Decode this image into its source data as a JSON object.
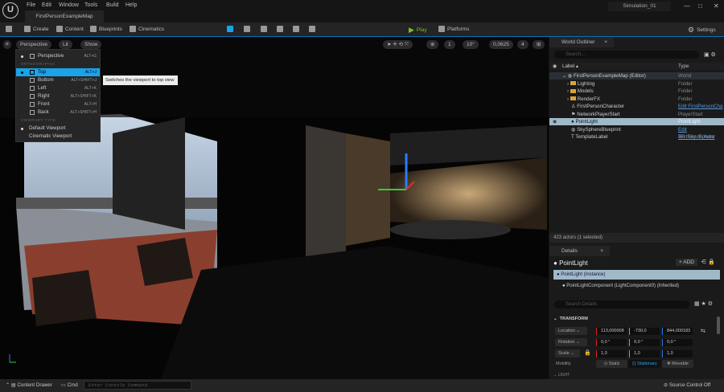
{
  "titlebar": {
    "logo": "U",
    "menus": [
      "File",
      "Edit",
      "Window",
      "Tools",
      "Build",
      "Help"
    ],
    "map_tab": "FirstPersonExampleMap",
    "project_tab": "Simulation_01",
    "window_controls": [
      "—",
      "□",
      "✕"
    ]
  },
  "toolbar": {
    "create": "Create",
    "content": "Content",
    "blueprints": "Blueprints",
    "cinematics": "Cinematics",
    "play": "Play",
    "platforms": "Platforms",
    "settings": "Settings"
  },
  "viewport": {
    "perspective": "Perspective",
    "lit": "Lit",
    "show": "Show",
    "grid_snap": "1",
    "rotation_snap": "10°",
    "scale_snap": "0,0625",
    "camera_speed": "4"
  },
  "view_menu": {
    "items": [
      {
        "label": "Perspective",
        "shortcut": "ALT+G"
      },
      {
        "label": "Top",
        "shortcut": "ALT+J"
      },
      {
        "label": "Bottom",
        "shortcut": "ALT+SHIFT+J"
      },
      {
        "label": "Left",
        "shortcut": "ALT+K"
      },
      {
        "label": "Right",
        "shortcut": "ALT+SHIFT+K"
      },
      {
        "label": "Front",
        "shortcut": "ALT+H"
      },
      {
        "label": "Back",
        "shortcut": "ALT+SHIFT+H"
      },
      {
        "label": "Default Viewport",
        "shortcut": ""
      },
      {
        "label": "Cinematic Viewport",
        "shortcut": ""
      }
    ],
    "section_ortho": "ORTHOGRAPHIC",
    "section_type": "VIEWPORT TYPE",
    "tooltip": "Switches the viewport to top view"
  },
  "outliner": {
    "title": "World Outliner",
    "search_placeholder": "Search...",
    "col_label": "Label ▴",
    "col_type": "Type",
    "rows": [
      {
        "label": "FirstPersonExampleMap (Editor)",
        "type": "World"
      },
      {
        "label": "Lighting",
        "type": "Folder"
      },
      {
        "label": "Models",
        "type": "Folder"
      },
      {
        "label": "RenderFX",
        "type": "Folder"
      },
      {
        "label": "FirstPersonCharacter",
        "type": "Edit FirstPersonCha"
      },
      {
        "label": "NetworkPlayerStart",
        "type": "PlayerStart"
      },
      {
        "label": "PointLight",
        "type": "PointLight"
      },
      {
        "label": "SkySphereBlueprint",
        "type": "Edit BP_Sky_Sphere"
      },
      {
        "label": "TemplateLabel",
        "type": "TextRenderActor"
      }
    ],
    "status": "423 actors (1 selected)"
  },
  "details": {
    "title": "Details",
    "actor": "PointLight",
    "add": "+ ADD",
    "instance": "PointLight  (Instance)",
    "component": "PointLightComponent (LightComponent0) (Inherited)",
    "search_placeholder": "Search Details",
    "section": "TRANSFORM",
    "location_label": "Location",
    "location": [
      "113,000008",
      "-730,0",
      "844,000183"
    ],
    "rotation_label": "Rotation",
    "rotation": [
      "0,0 °",
      "0,0 °",
      "0,0 °"
    ],
    "scale_label": "Scale",
    "scale": [
      "1,0",
      "1,0",
      "1,0"
    ],
    "mobility_label": "Mobility",
    "mobility": [
      "Static",
      "Stationary",
      "Movable"
    ],
    "next_section": "LIGHT"
  },
  "bottom": {
    "content_drawer": "Content Drawer",
    "cmd": "Cmd",
    "console_placeholder": "Enter Console Command",
    "source_control": "Source Control Off"
  },
  "colors": {
    "accent": "#0a6fb5",
    "selected_row": "#9fb9c9",
    "menu_highlight": "#1aa3e8",
    "play": "#7bbf2a"
  }
}
